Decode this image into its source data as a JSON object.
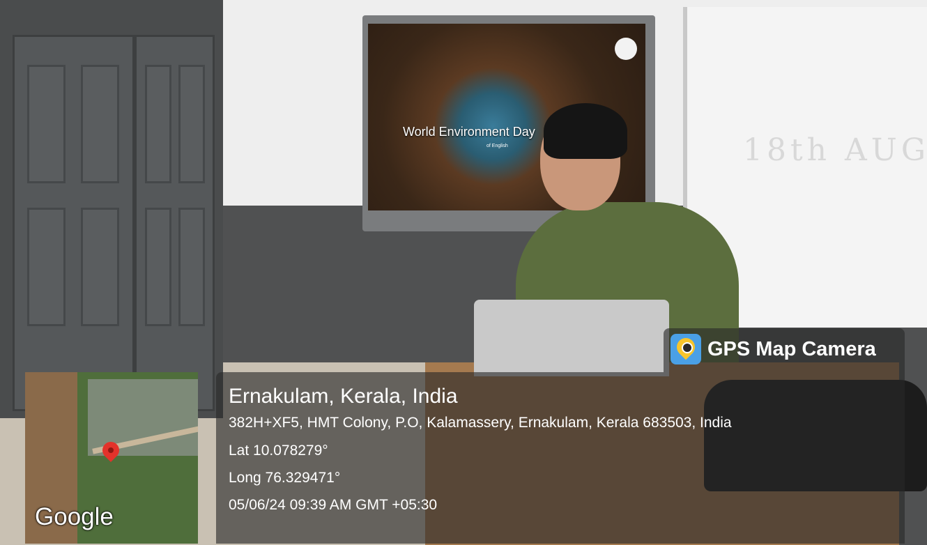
{
  "screen": {
    "slide_title": "World Environment Day",
    "slide_subtitle": "of English",
    "whiteboard_text": "18th AUG"
  },
  "map": {
    "logo_text": "Google",
    "pin_color": "#e3322b"
  },
  "gps_badge": {
    "label": "GPS Map Camera",
    "icon": "gps-map-camera-icon"
  },
  "location": {
    "city": "Ernakulam, Kerala, India",
    "address": "382H+XF5, HMT Colony, P.O, Kalamassery, Ernakulam, Kerala 683503, India",
    "lat": "Lat 10.078279°",
    "long": "Long 76.329471°",
    "timestamp": "05/06/24 09:39 AM GMT +05:30"
  }
}
